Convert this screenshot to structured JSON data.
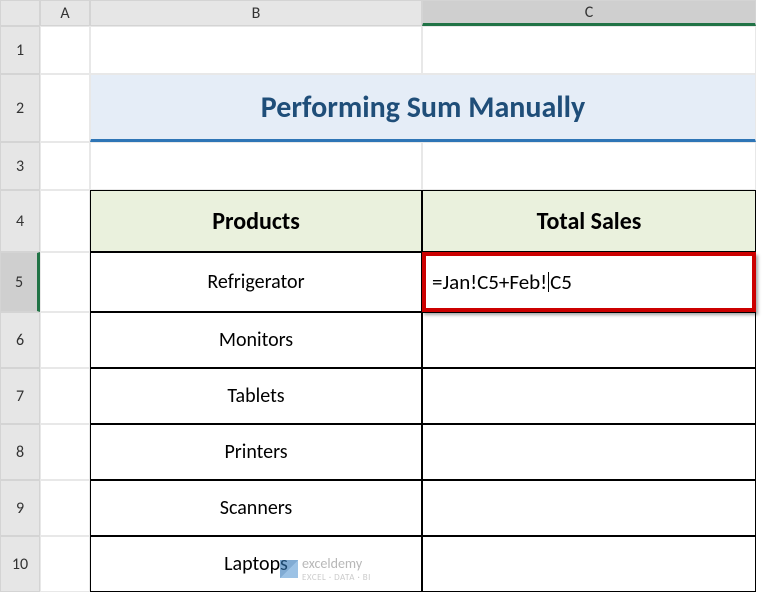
{
  "columns": {
    "rowhead": "",
    "A": "A",
    "B": "B",
    "C": "C"
  },
  "rows": {
    "1": "1",
    "2": "2",
    "3": "3",
    "4": "4",
    "5": "5",
    "6": "6",
    "7": "7",
    "8": "8",
    "9": "9",
    "10": "10"
  },
  "title": "Performing Sum Manually",
  "table": {
    "headers": {
      "products": "Products",
      "total": "Total Sales"
    },
    "rows": [
      {
        "product": "Refrigerator"
      },
      {
        "product": "Monitors"
      },
      {
        "product": "Tablets"
      },
      {
        "product": "Printers"
      },
      {
        "product": "Scanners"
      },
      {
        "product": "Laptops"
      }
    ]
  },
  "formula": {
    "prefix": "=Jan!C5+Feb!",
    "suffix": "C5"
  },
  "watermark": {
    "text": "exceldemy",
    "sub": "EXCEL · DATA · BI"
  }
}
